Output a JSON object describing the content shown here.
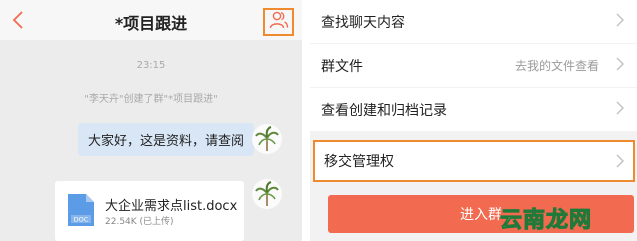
{
  "chat": {
    "title": "*项目跟进",
    "timestamp": "23:15",
    "system_message": "\"李天卉\"创建了群\"*项目跟进\"",
    "messages": [
      {
        "type": "text",
        "text": "大家好，这是资料，请查阅"
      },
      {
        "type": "file",
        "file_name": "大企业需求点list.docx",
        "file_meta": "22.54K (已上传)",
        "file_icon_label": "DOC"
      }
    ]
  },
  "settings": {
    "rows": [
      {
        "label": "查找聊天内容"
      },
      {
        "label": "群文件",
        "value": "去我的文件查看"
      },
      {
        "label": "查看创建和归档记录"
      },
      {
        "label": "移交管理权"
      }
    ],
    "enter_button": "进入群"
  },
  "watermark": "云南龙网",
  "colors": {
    "accent_orange": "#f08a2e",
    "back_arrow": "#f26a4f",
    "enter_button": "#f26a4f",
    "bubble": "#d8e6f6",
    "doc_icon": "#5c9ce6"
  },
  "icons": {
    "back": "chevron-left-icon",
    "members": "group-members-icon",
    "file": "doc-file-icon",
    "chevron": "chevron-right-icon"
  }
}
